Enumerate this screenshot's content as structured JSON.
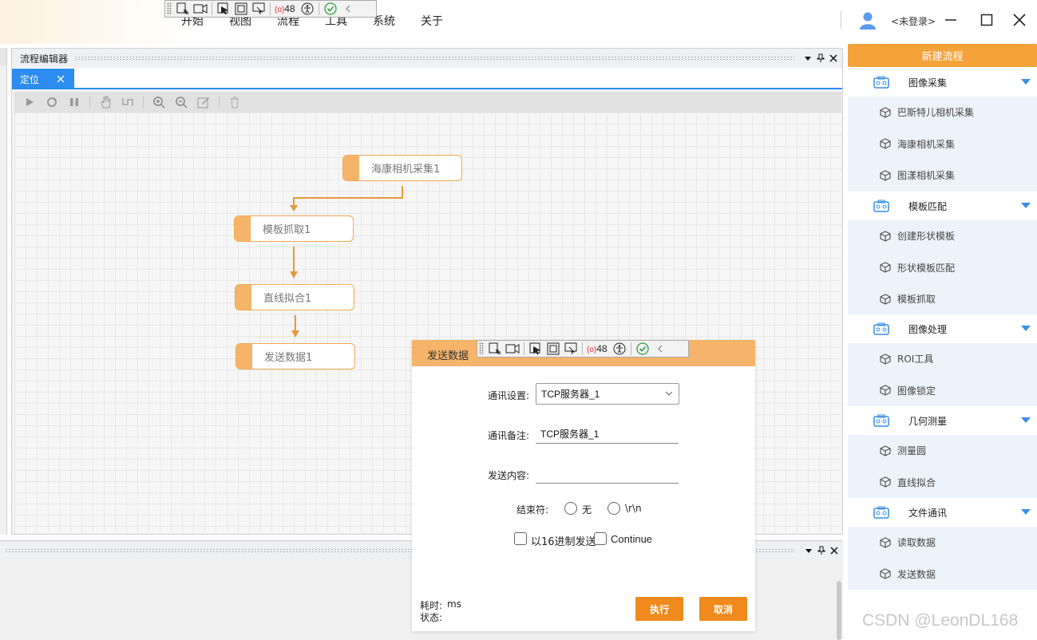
{
  "menu": [
    "开始",
    "视图",
    "流程",
    "工具",
    "系统",
    "关于"
  ],
  "user": {
    "label": "<未登录>"
  },
  "debug_toolbar": {
    "count": "48"
  },
  "editor": {
    "title": "流程编辑器",
    "tab_label": "定位",
    "nodes": [
      "海康相机采集1",
      "模板抓取1",
      "直线拟合1",
      "发送数据1"
    ]
  },
  "toolbox": {
    "new_flow": "新建流程",
    "categories": [
      {
        "label": "图像采集",
        "items": [
          "巴斯特儿相机采集",
          "海康相机采集",
          "图漾相机采集"
        ]
      },
      {
        "label": "模板匹配",
        "items": [
          "创建形状模板",
          "形状模板匹配",
          "模板抓取"
        ]
      },
      {
        "label": "图像处理",
        "items": [
          "ROI工具",
          "图像锁定"
        ]
      },
      {
        "label": "几何测量",
        "items": [
          "测量圆",
          "直线拟合"
        ]
      },
      {
        "label": "文件通讯",
        "items": [
          "读取数据",
          "发送数据"
        ]
      }
    ]
  },
  "dialog": {
    "title": "发送数据",
    "comm_setting_label": "通讯设置:",
    "comm_setting_value": "TCP服务器_1",
    "comm_note_label": "通讯备注:",
    "comm_note_value": "TCP服务器_1",
    "send_content_label": "发送内容:",
    "send_content_value": "",
    "terminator_label": "结束符:",
    "terminator_options": [
      "无",
      "\\r\\n"
    ],
    "hex_send_label": "以16进制发送",
    "continue_label": "Continue",
    "time_label": "耗时:",
    "time_value": "ms",
    "status_label": "状态:",
    "execute_label": "执行",
    "cancel_label": "取消"
  },
  "watermark": "CSDN @LeonDL168",
  "colors": {
    "accent_orange": "#f5a23a",
    "tab_blue": "#2d8cf0",
    "node_bar": "#f5b46a",
    "tree_blue": "#3a8ee6"
  }
}
